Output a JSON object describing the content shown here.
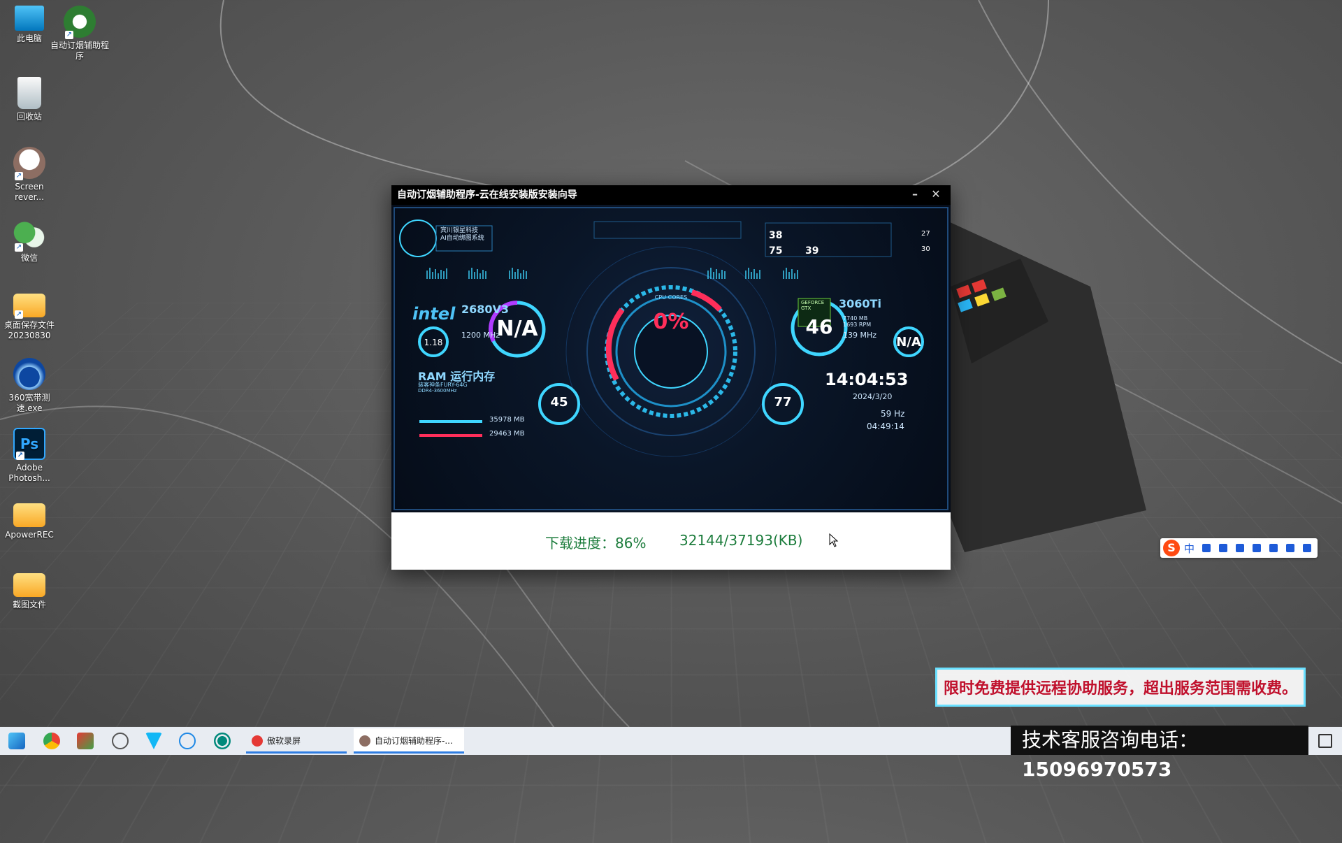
{
  "desktop": {
    "icons": [
      {
        "label": "此电脑",
        "icon": "computer-icon"
      },
      {
        "label": "自动订烟辅助程序",
        "icon": "app-shortcut-icon"
      },
      {
        "label": "回收站",
        "icon": "recycle-bin-icon"
      },
      {
        "label": "Screen rever...",
        "icon": "screen-recorder-icon"
      },
      {
        "label": "微信",
        "icon": "wechat-icon"
      },
      {
        "label": "桌面保存文件20230830",
        "icon": "folder-icon"
      },
      {
        "label": "360宽带测速.exe",
        "icon": "speedtest-icon"
      },
      {
        "label": "Adobe Photosh...",
        "icon": "photoshop-icon"
      },
      {
        "label": "ApowerREC",
        "icon": "folder-icon"
      },
      {
        "label": "截图文件",
        "icon": "folder-icon"
      }
    ]
  },
  "window": {
    "title": "自动订烟辅助程序-云在线安装版安装向导",
    "minimize": "–",
    "close": "✕",
    "banner": {
      "brand_line1": "宾川银星科技",
      "brand_line2": "AI自动绑图系统",
      "cpu_model": "2680V3",
      "cpu_brand": "intel",
      "cpu_temp": "N/A",
      "cpu_freq": "1200 MHz",
      "cpu_volt": "1.18",
      "cpu_usage": "0%",
      "cpu_ring_label": "CPU CORES",
      "gpu_model": "3060Ti",
      "gpu_temp": "46",
      "gpu_mem": "7740 MB",
      "gpu_rpm": "1693 RPM",
      "gpu_freq": "139 MHz",
      "gpu_na": "N/A",
      "gpu_badge": "GEFORCE GTX",
      "ram_title": "RAM 运行内存",
      "ram_subtitle": "骇客神条FURY-64G",
      "ram_type": "DDR4-3600MHz",
      "ram_used": "35978 MB",
      "ram_free": "29463 MB",
      "ram_gauge": "45",
      "disk_gauge": "77",
      "time": "14:04:53",
      "date": "2024/3/20",
      "refresh": "59 Hz",
      "uptime": "04:49:14",
      "top_nums": [
        "38",
        "75",
        "39",
        "27",
        "30"
      ]
    },
    "progress_label": "下载进度：86%",
    "progress_bytes": "32144/37193(KB)",
    "progress_percent": 86
  },
  "ime_bar": {
    "logo": "S",
    "mode": "中"
  },
  "promo": "限时免费提供远程协助服务，超出服务范围需收费。",
  "taskbar": {
    "tasks": [
      {
        "label": "傲软录屏",
        "icon": "record-icon"
      },
      {
        "label": "自动订烟辅助程序-...",
        "icon": "app-icon"
      }
    ],
    "hotline_label": "技术客服咨询电话：",
    "hotline_number": "15096970573"
  },
  "colors": {
    "accent": "#2f7de1",
    "progress_text": "#1c7c3c",
    "promo_text": "#c0102c",
    "banner_cyan": "#3fd6ff",
    "banner_red": "#ff2e5a"
  }
}
